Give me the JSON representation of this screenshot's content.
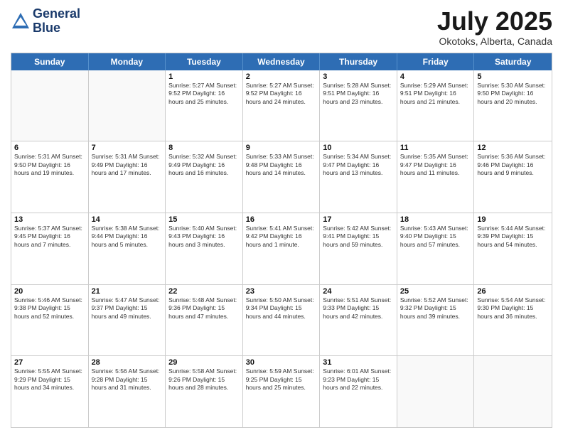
{
  "header": {
    "logo_line1": "General",
    "logo_line2": "Blue",
    "month": "July 2025",
    "location": "Okotoks, Alberta, Canada"
  },
  "days_of_week": [
    "Sunday",
    "Monday",
    "Tuesday",
    "Wednesday",
    "Thursday",
    "Friday",
    "Saturday"
  ],
  "weeks": [
    [
      {
        "day": "",
        "text": ""
      },
      {
        "day": "",
        "text": ""
      },
      {
        "day": "1",
        "text": "Sunrise: 5:27 AM\nSunset: 9:52 PM\nDaylight: 16 hours and 25 minutes."
      },
      {
        "day": "2",
        "text": "Sunrise: 5:27 AM\nSunset: 9:52 PM\nDaylight: 16 hours and 24 minutes."
      },
      {
        "day": "3",
        "text": "Sunrise: 5:28 AM\nSunset: 9:51 PM\nDaylight: 16 hours and 23 minutes."
      },
      {
        "day": "4",
        "text": "Sunrise: 5:29 AM\nSunset: 9:51 PM\nDaylight: 16 hours and 21 minutes."
      },
      {
        "day": "5",
        "text": "Sunrise: 5:30 AM\nSunset: 9:50 PM\nDaylight: 16 hours and 20 minutes."
      }
    ],
    [
      {
        "day": "6",
        "text": "Sunrise: 5:31 AM\nSunset: 9:50 PM\nDaylight: 16 hours and 19 minutes."
      },
      {
        "day": "7",
        "text": "Sunrise: 5:31 AM\nSunset: 9:49 PM\nDaylight: 16 hours and 17 minutes."
      },
      {
        "day": "8",
        "text": "Sunrise: 5:32 AM\nSunset: 9:49 PM\nDaylight: 16 hours and 16 minutes."
      },
      {
        "day": "9",
        "text": "Sunrise: 5:33 AM\nSunset: 9:48 PM\nDaylight: 16 hours and 14 minutes."
      },
      {
        "day": "10",
        "text": "Sunrise: 5:34 AM\nSunset: 9:47 PM\nDaylight: 16 hours and 13 minutes."
      },
      {
        "day": "11",
        "text": "Sunrise: 5:35 AM\nSunset: 9:47 PM\nDaylight: 16 hours and 11 minutes."
      },
      {
        "day": "12",
        "text": "Sunrise: 5:36 AM\nSunset: 9:46 PM\nDaylight: 16 hours and 9 minutes."
      }
    ],
    [
      {
        "day": "13",
        "text": "Sunrise: 5:37 AM\nSunset: 9:45 PM\nDaylight: 16 hours and 7 minutes."
      },
      {
        "day": "14",
        "text": "Sunrise: 5:38 AM\nSunset: 9:44 PM\nDaylight: 16 hours and 5 minutes."
      },
      {
        "day": "15",
        "text": "Sunrise: 5:40 AM\nSunset: 9:43 PM\nDaylight: 16 hours and 3 minutes."
      },
      {
        "day": "16",
        "text": "Sunrise: 5:41 AM\nSunset: 9:42 PM\nDaylight: 16 hours and 1 minute."
      },
      {
        "day": "17",
        "text": "Sunrise: 5:42 AM\nSunset: 9:41 PM\nDaylight: 15 hours and 59 minutes."
      },
      {
        "day": "18",
        "text": "Sunrise: 5:43 AM\nSunset: 9:40 PM\nDaylight: 15 hours and 57 minutes."
      },
      {
        "day": "19",
        "text": "Sunrise: 5:44 AM\nSunset: 9:39 PM\nDaylight: 15 hours and 54 minutes."
      }
    ],
    [
      {
        "day": "20",
        "text": "Sunrise: 5:46 AM\nSunset: 9:38 PM\nDaylight: 15 hours and 52 minutes."
      },
      {
        "day": "21",
        "text": "Sunrise: 5:47 AM\nSunset: 9:37 PM\nDaylight: 15 hours and 49 minutes."
      },
      {
        "day": "22",
        "text": "Sunrise: 5:48 AM\nSunset: 9:36 PM\nDaylight: 15 hours and 47 minutes."
      },
      {
        "day": "23",
        "text": "Sunrise: 5:50 AM\nSunset: 9:34 PM\nDaylight: 15 hours and 44 minutes."
      },
      {
        "day": "24",
        "text": "Sunrise: 5:51 AM\nSunset: 9:33 PM\nDaylight: 15 hours and 42 minutes."
      },
      {
        "day": "25",
        "text": "Sunrise: 5:52 AM\nSunset: 9:32 PM\nDaylight: 15 hours and 39 minutes."
      },
      {
        "day": "26",
        "text": "Sunrise: 5:54 AM\nSunset: 9:30 PM\nDaylight: 15 hours and 36 minutes."
      }
    ],
    [
      {
        "day": "27",
        "text": "Sunrise: 5:55 AM\nSunset: 9:29 PM\nDaylight: 15 hours and 34 minutes."
      },
      {
        "day": "28",
        "text": "Sunrise: 5:56 AM\nSunset: 9:28 PM\nDaylight: 15 hours and 31 minutes."
      },
      {
        "day": "29",
        "text": "Sunrise: 5:58 AM\nSunset: 9:26 PM\nDaylight: 15 hours and 28 minutes."
      },
      {
        "day": "30",
        "text": "Sunrise: 5:59 AM\nSunset: 9:25 PM\nDaylight: 15 hours and 25 minutes."
      },
      {
        "day": "31",
        "text": "Sunrise: 6:01 AM\nSunset: 9:23 PM\nDaylight: 15 hours and 22 minutes."
      },
      {
        "day": "",
        "text": ""
      },
      {
        "day": "",
        "text": ""
      }
    ]
  ]
}
